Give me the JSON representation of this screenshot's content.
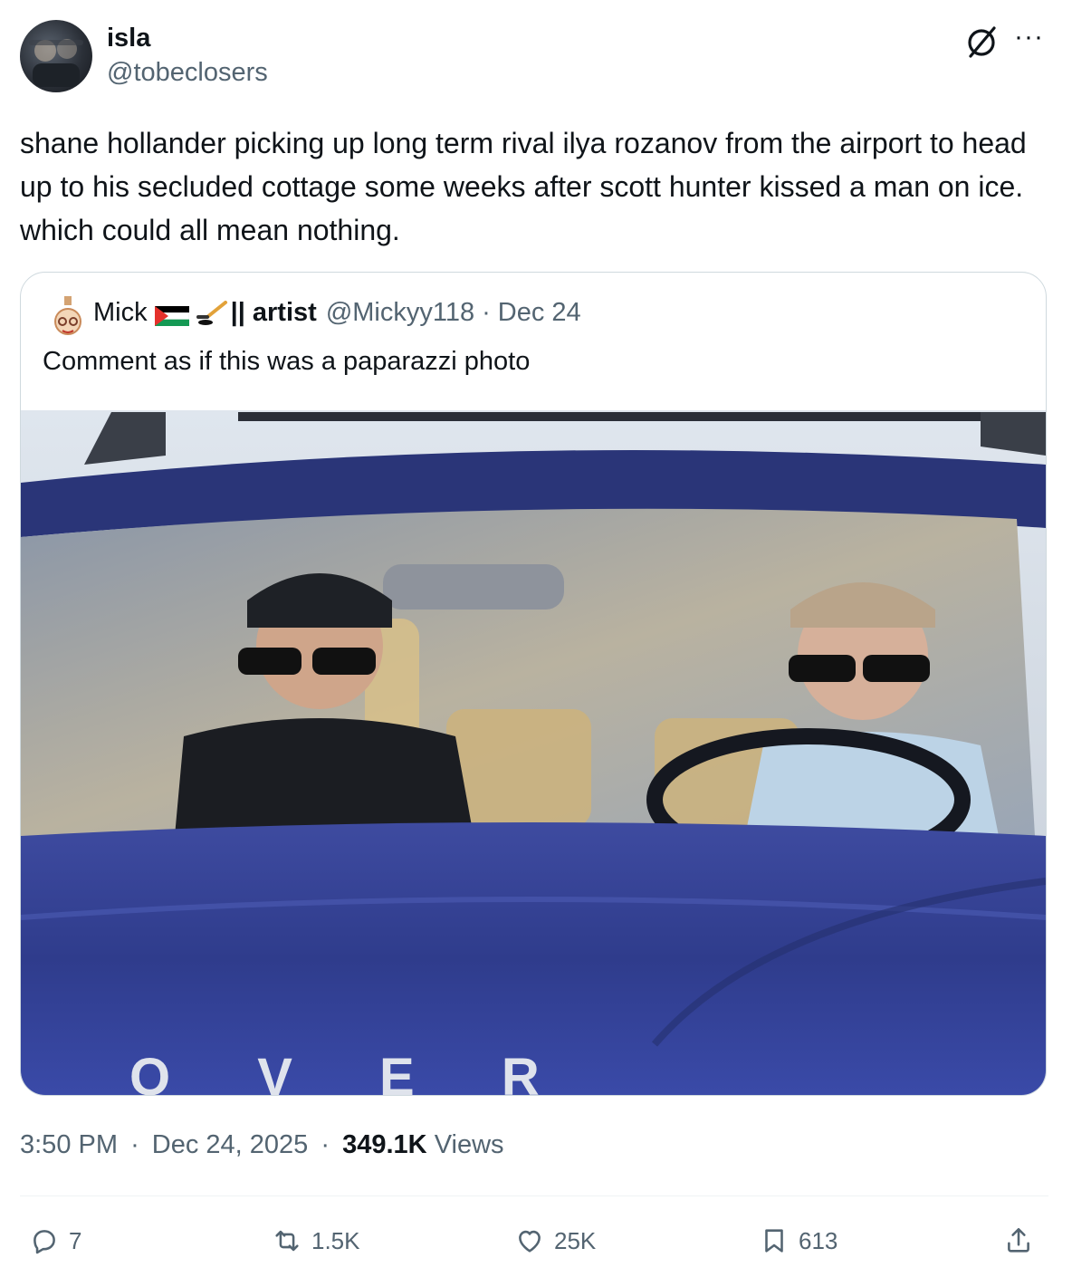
{
  "author": {
    "display_name": "isla",
    "handle": "@tobeclosers"
  },
  "header_icons": [
    "grok-icon",
    "more-icon"
  ],
  "tweet": {
    "text": "shane hollander picking up long term rival ilya rozanov from the airport to head up to his secluded cottage some weeks after scott hunter kissed a man on ice. which could all mean nothing."
  },
  "quote": {
    "name": "Mick",
    "name_suffix": "|| artist",
    "handle": "@Mickyy118",
    "separator": "·",
    "date": "Dec 24",
    "text": "Comment as if this was a paparazzi photo",
    "photo_caption_letters": "O V E R",
    "flag_colors": {
      "black": "#000000",
      "white": "#ffffff",
      "green": "#149954",
      "red": "#e4312b"
    }
  },
  "meta": {
    "time": "3:50 PM",
    "sep1": "·",
    "date": "Dec 24, 2025",
    "sep2": "·",
    "views_count": "349.1K",
    "views_label": "Views"
  },
  "actions": {
    "replies": "7",
    "retweets": "1.5K",
    "likes": "25K",
    "bookmarks": "613"
  },
  "colors": {
    "text": "#0f1419",
    "secondary": "#536471",
    "border": "#cfd9de",
    "car_body": "#2c3a8a"
  }
}
